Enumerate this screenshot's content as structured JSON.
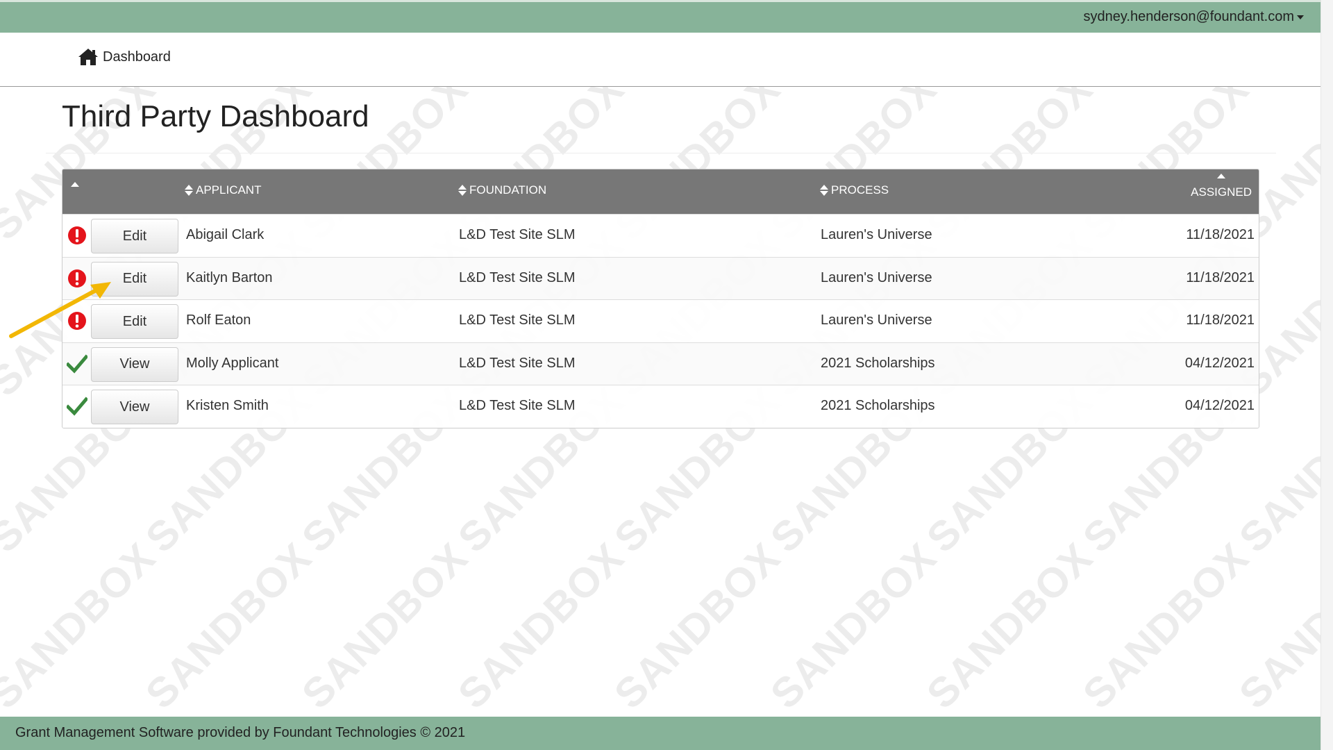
{
  "header": {
    "user_email": "sydney.henderson@foundant.com"
  },
  "nav": {
    "home_label": "Dashboard",
    "home_icon": "home-icon"
  },
  "page": {
    "title": "Third Party Dashboard",
    "watermark": "SANDBOX"
  },
  "table": {
    "columns": {
      "applicant": "APPLICANT",
      "foundation": "FOUNDATION",
      "process": "PROCESS",
      "assigned": "ASSIGNED"
    },
    "rows": [
      {
        "status": "error",
        "action": "Edit",
        "applicant": "Abigail Clark",
        "foundation": "L&D Test Site SLM",
        "process": "Lauren's Universe",
        "assigned": "11/18/2021"
      },
      {
        "status": "error",
        "action": "Edit",
        "applicant": "Kaitlyn Barton",
        "foundation": "L&D Test Site SLM",
        "process": "Lauren's Universe",
        "assigned": "11/18/2021"
      },
      {
        "status": "error",
        "action": "Edit",
        "applicant": "Rolf Eaton",
        "foundation": "L&D Test Site SLM",
        "process": "Lauren's Universe",
        "assigned": "11/18/2021"
      },
      {
        "status": "complete",
        "action": "View",
        "applicant": "Molly Applicant",
        "foundation": "L&D Test Site SLM",
        "process": "2021 Scholarships",
        "assigned": "04/12/2021"
      },
      {
        "status": "complete",
        "action": "View",
        "applicant": "Kristen Smith",
        "foundation": "L&D Test Site SLM",
        "process": "2021 Scholarships",
        "assigned": "04/12/2021"
      }
    ]
  },
  "footer": {
    "text": "Grant Management Software provided by Foundant Technologies © 2021"
  },
  "colors": {
    "bar_green": "#87b399",
    "header_gray": "#777777",
    "error_red": "#e4141b",
    "check_green": "#3a8a3e",
    "annotation_arrow": "#f2b705"
  }
}
